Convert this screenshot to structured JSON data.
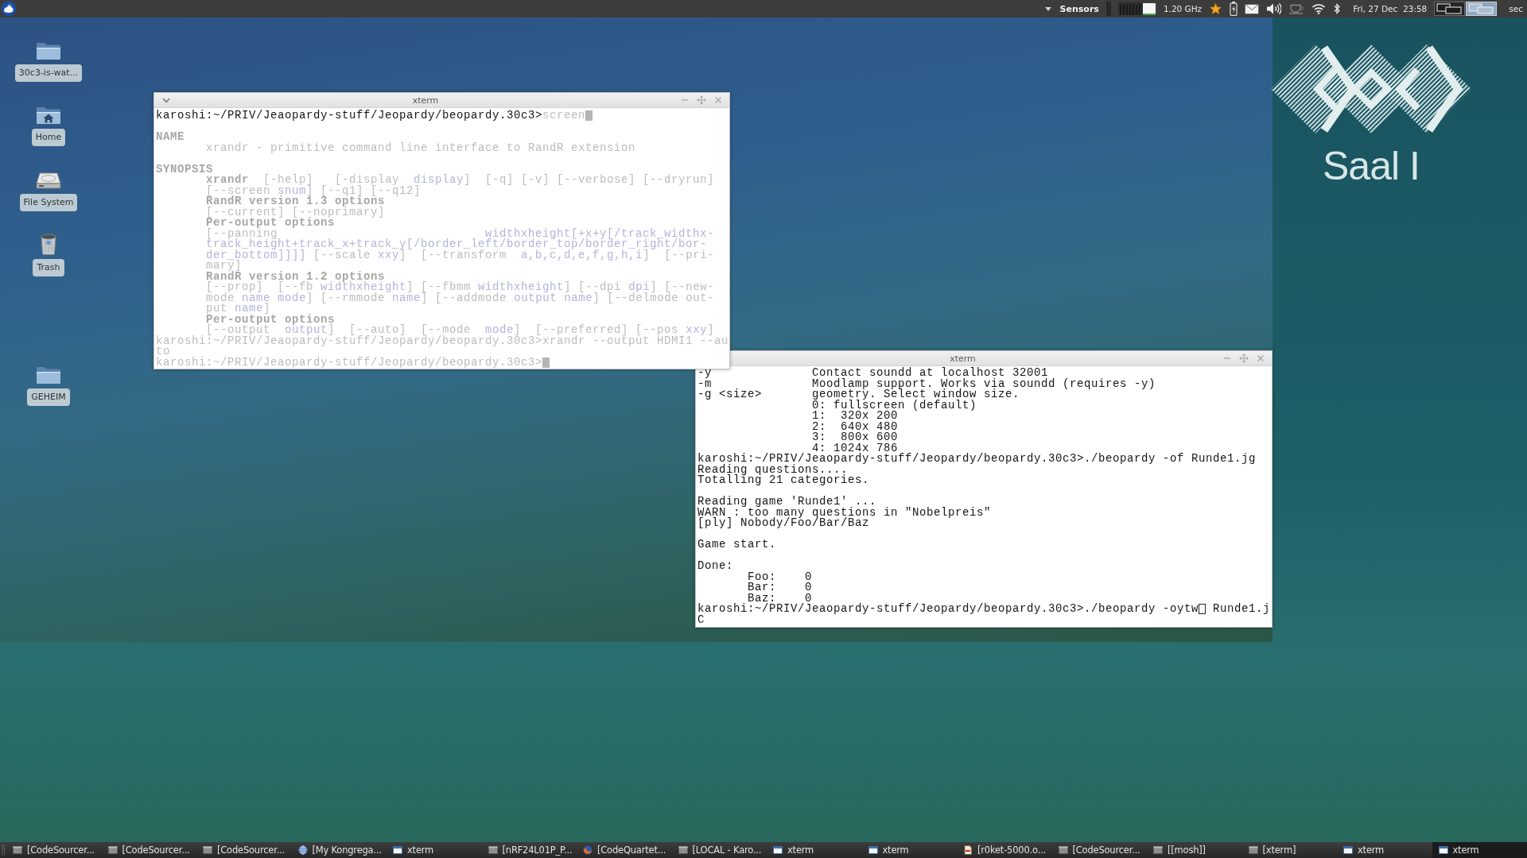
{
  "top_panel": {
    "sensors": "Sensors",
    "cpu_frequency": "1.20 GHz",
    "clock": "Fri, 27 Dec  23:58",
    "workspaces": [
      {
        "selected": false
      },
      {
        "selected": true
      }
    ],
    "edge_text": "sec"
  },
  "desktop_icons": [
    {
      "kind": "folder",
      "label": "30c3-is-wat..."
    },
    {
      "kind": "home",
      "label": "Home"
    },
    {
      "kind": "drive",
      "label": "File System"
    },
    {
      "kind": "trash",
      "label": "Trash"
    },
    {
      "kind": "folder",
      "label": "GEHEIM"
    }
  ],
  "logo": {
    "caption": "Saal I"
  },
  "windows": [
    {
      "title": "xterm",
      "menu": true,
      "focused": true,
      "blocks": [
        {
          "lines": [
            {
              "kind": "prompt",
              "prompt": "karoshi:~/PRIV/Jeaopardy-stuff/Jeopardy/beopardy.30c3>",
              "command": "screen",
              "faded": false,
              "command_faded": true,
              "cursor": true
            }
          ]
        },
        {
          "lines": [
            {
              "kind": "heading",
              "text": "NAME",
              "faded": true
            },
            {
              "kind": "body",
              "text": "xrandr - primitive command line interface to RandR extension",
              "faded": true
            }
          ]
        },
        {
          "lines": [
            {
              "kind": "heading",
              "text": "SYNOPSIS",
              "faded": true
            },
            {
              "kind": "body",
              "text": "**xrandr**  [-help]   [-display  *display*]  [-q] [-v] [--verbose] [--dryrun]",
              "faded": true
            },
            {
              "kind": "body",
              "text": "[--screen *snum*] [--q1] [--q12]",
              "faded": true
            },
            {
              "kind": "subheading",
              "text": "RandR version 1.3 options",
              "faded": true
            },
            {
              "kind": "body",
              "text": "[--current] [--noprimary]",
              "faded": true
            },
            {
              "kind": "subheading",
              "text": "Per-output options",
              "faded": true
            },
            {
              "kind": "body",
              "text": "[--panning                             *widthxheight[+x+y[/track_widthx-*",
              "faded": true
            },
            {
              "kind": "body",
              "text": "*track_height+track_x+track_y[/border_left/border_top/border_right/bor-*",
              "faded": true
            },
            {
              "kind": "body",
              "text": "*der_bottom]]]]* [--scale *xxy*]  [--transform  *a,b,c,d,e,f,g,h,i*]  [--pri-",
              "faded": true
            },
            {
              "kind": "body",
              "text": "mary]",
              "faded": true
            },
            {
              "kind": "subheading",
              "text": "RandR version 1.2 options",
              "faded": true
            },
            {
              "kind": "body",
              "text": "[--prop]  [--fb *widthxheight*] [--fbmm *widthxheight*] [--dpi *dpi*] [--new-",
              "faded": true
            },
            {
              "kind": "body",
              "text": "mode *name* *mode*] [--rmmode *name*] [--addmode *output* *name*] [--delmode out-",
              "faded": true
            },
            {
              "kind": "body",
              "text": "put *name*]",
              "faded": true
            },
            {
              "kind": "subheading",
              "text": "Per-output options",
              "faded": true
            },
            {
              "kind": "body",
              "text": "[--output  *output*]  [--auto]  [--mode  *mode*]  [--preferred] [--pos *xxy*]",
              "faded": true
            },
            {
              "kind": "prompt",
              "prompt": "karoshi:~/PRIV/Jeaopardy-stuff/Jeopardy/beopardy.30c3>",
              "command": "xrandr --output HDMI1 --au",
              "faded": true,
              "command_faded": true,
              "cursor": false
            },
            {
              "kind": "output",
              "text": "to",
              "faded": true
            },
            {
              "kind": "prompt",
              "prompt": "karoshi:~/PRIV/Jeaopardy-stuff/Jeopardy/beopardy.30c3>",
              "faded": true,
              "cursor": true
            }
          ]
        }
      ]
    },
    {
      "title": "xterm",
      "menu": false,
      "focused": false,
      "blocks": [
        {
          "lines": [
            {
              "kind": "option",
              "flag": "-y",
              "text": "Contact soundd at localhost 32001",
              "faded": false
            },
            {
              "kind": "option",
              "flag": "-m",
              "text": "Moodlamp support. Works via soundd (requires -y)",
              "faded": false
            },
            {
              "kind": "option",
              "flag": "-g <size>",
              "text": "geometry. Select window size.",
              "faded": false
            },
            {
              "kind": "option",
              "text": "0: fullscreen (default)",
              "faded": false
            },
            {
              "kind": "option",
              "text": "1:  320x 200",
              "faded": false
            },
            {
              "kind": "option",
              "text": "2:  640x 480",
              "faded": false
            },
            {
              "kind": "option",
              "text": "3:  800x 600",
              "faded": false
            },
            {
              "kind": "option",
              "text": "4: 1024x 786",
              "faded": false
            },
            {
              "kind": "prompt",
              "prompt": "karoshi:~/PRIV/Jeaopardy-stuff/Jeopardy/beopardy.30c3>",
              "command": "./beopardy -of Runde1.jg",
              "faded": false,
              "command_faded": false,
              "cursor": false
            },
            {
              "kind": "output",
              "text": "Reading questions....",
              "faded": false
            },
            {
              "kind": "output",
              "text": "Totalling 21 categories.",
              "faded": false
            }
          ]
        },
        {
          "lines": [
            {
              "kind": "output",
              "text": "Reading game 'Runde1' ...",
              "faded": false
            },
            {
              "kind": "output",
              "text": "WARN : too many questions in \"Nobelpreis\"",
              "faded": false
            },
            {
              "kind": "output",
              "text": "[ply] Nobody/Foo/Bar/Baz",
              "faded": false
            }
          ]
        },
        {
          "lines": [
            {
              "kind": "output",
              "text": "Game start.",
              "faded": false
            }
          ]
        },
        {
          "lines": [
            {
              "kind": "output",
              "text": "Done:",
              "faded": false
            },
            {
              "kind": "body",
              "text": "Foo:    0",
              "faded": false
            },
            {
              "kind": "body",
              "text": "Bar:    0",
              "faded": false
            },
            {
              "kind": "body",
              "text": "Baz:    0",
              "faded": false
            },
            {
              "kind": "prompt",
              "prompt": "karoshi:~/PRIV/Jeaopardy-stuff/Jeopardy/beopardy.30c3>",
              "command": "./beopardy -oytw",
              "faded": false,
              "command_faded": false,
              "cursor": true,
              "tail": "Runde1.j"
            },
            {
              "kind": "output",
              "text": "C",
              "faded": false
            }
          ]
        }
      ]
    }
  ],
  "taskbar": [
    {
      "kind": "window",
      "label": "[CodeSourcer...",
      "selected": false
    },
    {
      "kind": "window",
      "label": "[CodeSourcer...",
      "selected": false
    },
    {
      "kind": "window",
      "label": "[CodeSourcer...",
      "selected": false
    },
    {
      "kind": "globe",
      "label": "[My Kongrega...",
      "selected": false
    },
    {
      "kind": "terminal",
      "label": "xterm",
      "selected": false
    },
    {
      "kind": "window",
      "label": "[nRF24L01P_P...",
      "selected": false
    },
    {
      "kind": "swirl",
      "label": "[CodeQuartet...",
      "selected": false
    },
    {
      "kind": "window",
      "label": "[LOCAL - Karo...",
      "selected": false
    },
    {
      "kind": "terminal",
      "label": "xterm",
      "selected": false
    },
    {
      "kind": "terminal",
      "label": "xterm",
      "selected": false
    },
    {
      "kind": "document",
      "label": "[r0ket-5000.o...",
      "selected": false
    },
    {
      "kind": "window",
      "label": "[CodeSourcer...",
      "selected": false
    },
    {
      "kind": "window",
      "label": "[[mosh]]",
      "selected": false
    },
    {
      "kind": "window",
      "label": "[xterm]",
      "selected": false
    },
    {
      "kind": "terminal",
      "label": "xterm",
      "selected": false
    },
    {
      "kind": "terminal",
      "label": "xterm",
      "selected": true
    }
  ]
}
